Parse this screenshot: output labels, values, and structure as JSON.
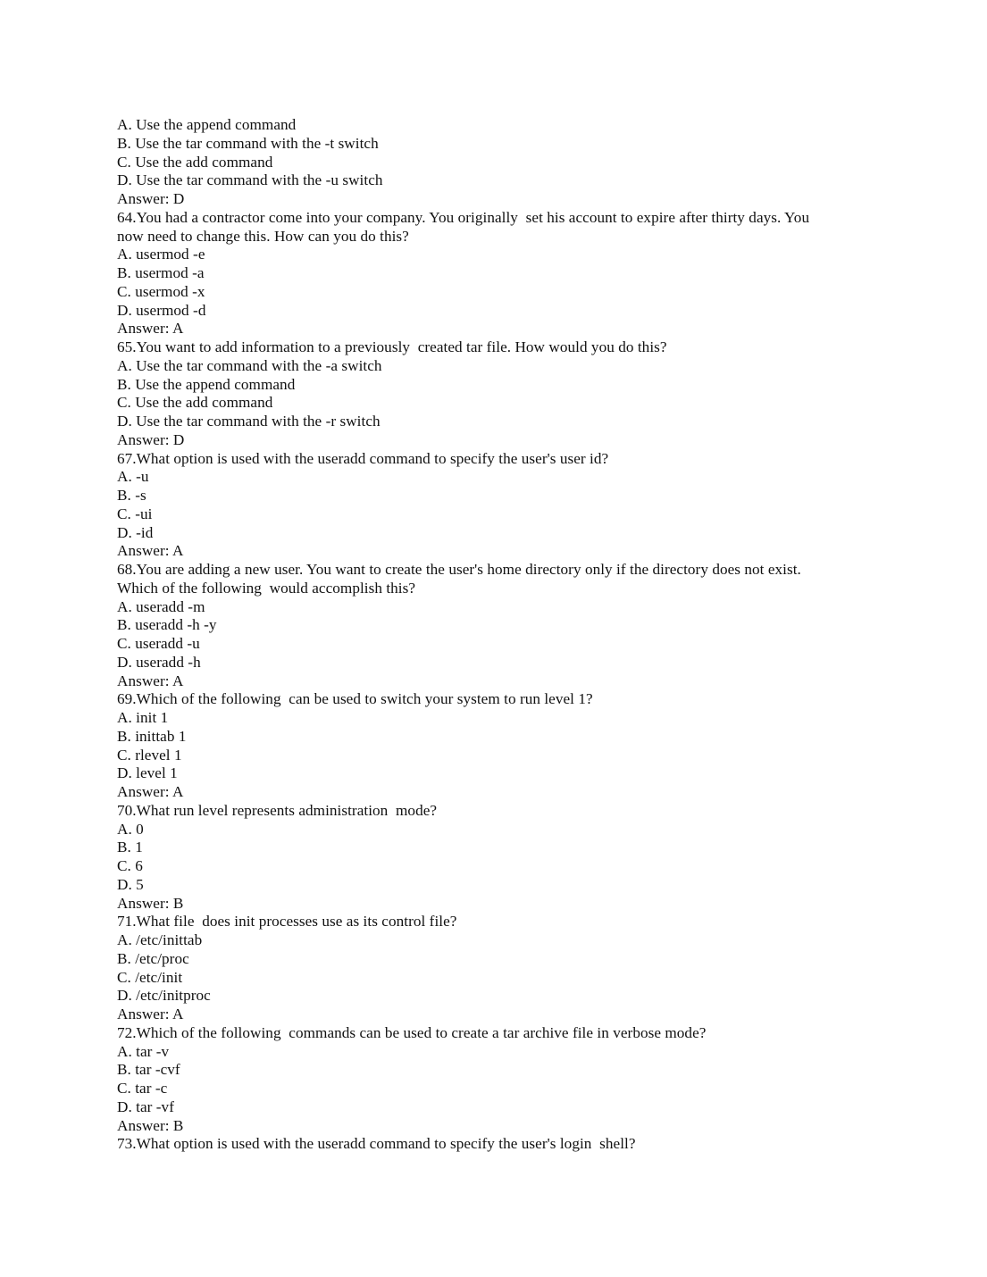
{
  "document": {
    "page_background": "#ffffff",
    "text_color": "#111111",
    "lines": [
      {
        "kind": "option",
        "text": "A. Use the append command"
      },
      {
        "kind": "option",
        "text": "B. Use the tar command with the -t switch"
      },
      {
        "kind": "option",
        "text": "C. Use the add command"
      },
      {
        "kind": "option",
        "text": "D. Use the tar command with the -u switch"
      },
      {
        "kind": "answer",
        "text": "Answer: D"
      },
      {
        "kind": "question",
        "text": "64.You had a contractor come into your company. You originally  set his account to expire after thirty days. You now need to change this. How can you do this?"
      },
      {
        "kind": "option",
        "text": "A. usermod -e"
      },
      {
        "kind": "option",
        "text": "B. usermod -a"
      },
      {
        "kind": "option",
        "text": "C. usermod -x"
      },
      {
        "kind": "option",
        "text": "D. usermod -d"
      },
      {
        "kind": "answer",
        "text": "Answer: A"
      },
      {
        "kind": "question",
        "text": "65.You want to add information to a previously  created tar file. How would you do this?"
      },
      {
        "kind": "option",
        "text": "A. Use the tar command with the -a switch"
      },
      {
        "kind": "option",
        "text": "B. Use the append command"
      },
      {
        "kind": "option",
        "text": "C. Use the add command"
      },
      {
        "kind": "option",
        "text": "D. Use the tar command with the -r switch"
      },
      {
        "kind": "answer",
        "text": "Answer: D"
      },
      {
        "kind": "question",
        "text": "67.What option is used with the useradd command to specify the user's user id?"
      },
      {
        "kind": "option",
        "text": "A. -u"
      },
      {
        "kind": "option",
        "text": "B. -s"
      },
      {
        "kind": "option",
        "text": "C. -ui"
      },
      {
        "kind": "option",
        "text": "D. -id"
      },
      {
        "kind": "answer",
        "text": "Answer: A"
      },
      {
        "kind": "question",
        "text": "68.You are adding a new user. You want to create the user's home directory only if the directory does not exist. Which of the following  would accomplish this?"
      },
      {
        "kind": "option",
        "text": "A. useradd -m"
      },
      {
        "kind": "option",
        "text": "B. useradd -h -y"
      },
      {
        "kind": "option",
        "text": "C. useradd -u"
      },
      {
        "kind": "option",
        "text": "D. useradd -h"
      },
      {
        "kind": "answer",
        "text": "Answer: A"
      },
      {
        "kind": "question",
        "text": "69.Which of the following  can be used to switch your system to run level 1?"
      },
      {
        "kind": "option",
        "text": "A. init 1"
      },
      {
        "kind": "option",
        "text": "B. inittab 1"
      },
      {
        "kind": "option",
        "text": "C. rlevel 1"
      },
      {
        "kind": "option",
        "text": "D. level 1"
      },
      {
        "kind": "answer",
        "text": "Answer: A"
      },
      {
        "kind": "question",
        "text": "70.What run level represents administration  mode?"
      },
      {
        "kind": "option",
        "text": "A. 0"
      },
      {
        "kind": "option",
        "text": "B. 1"
      },
      {
        "kind": "option",
        "text": "C. 6"
      },
      {
        "kind": "option",
        "text": "D. 5"
      },
      {
        "kind": "answer",
        "text": "Answer: B"
      },
      {
        "kind": "question",
        "text": "71.What file  does init processes use as its control file?"
      },
      {
        "kind": "option",
        "text": "A. /etc/inittab"
      },
      {
        "kind": "option",
        "text": "B. /etc/proc"
      },
      {
        "kind": "option",
        "text": "C. /etc/init"
      },
      {
        "kind": "option",
        "text": "D. /etc/initproc"
      },
      {
        "kind": "answer",
        "text": "Answer: A"
      },
      {
        "kind": "question",
        "text": "72.Which of the following  commands can be used to create a tar archive file in verbose mode?"
      },
      {
        "kind": "option",
        "text": "A. tar -v"
      },
      {
        "kind": "option",
        "text": "B. tar -cvf"
      },
      {
        "kind": "option",
        "text": "C. tar -c"
      },
      {
        "kind": "option",
        "text": "D. tar -vf"
      },
      {
        "kind": "answer",
        "text": "Answer: B"
      },
      {
        "kind": "question",
        "text": "73.What option is used with the useradd command to specify the user's login  shell?"
      }
    ]
  }
}
